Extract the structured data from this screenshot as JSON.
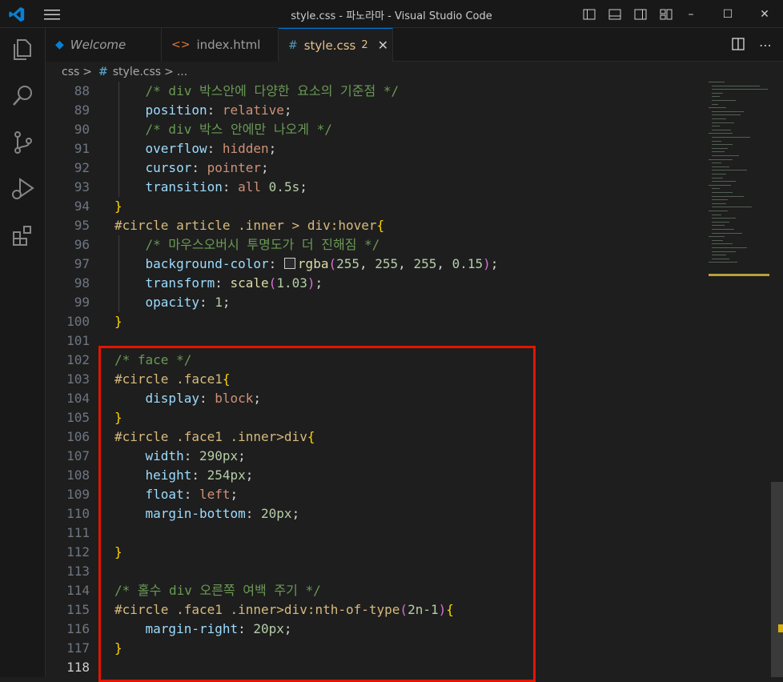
{
  "window": {
    "title": "style.css - 파노라마 - Visual Studio Code",
    "controls": {
      "minimize": "–",
      "maximize": "☐",
      "close": "✕"
    }
  },
  "activity_bar": [
    {
      "name": "explorer-icon"
    },
    {
      "name": "search-icon"
    },
    {
      "name": "source-control-icon"
    },
    {
      "name": "run-debug-icon"
    },
    {
      "name": "extensions-icon"
    }
  ],
  "tabs": [
    {
      "label": "Welcome",
      "icon": "vscode-icon",
      "active": false
    },
    {
      "label": "index.html",
      "icon": "html-icon",
      "active": false
    },
    {
      "label": "style.css",
      "icon": "css-icon",
      "active": true,
      "badge": "2",
      "close": "✕"
    }
  ],
  "breadcrumb": {
    "folder": "css",
    "sep": ">",
    "file": "style.css",
    "tail": "..."
  },
  "editor": {
    "lines": [
      {
        "n": "88",
        "indent": "    ",
        "tokens": [
          [
            "cm",
            "/* div 박스안에 다양한 요소의 기준점 */"
          ]
        ]
      },
      {
        "n": "89",
        "indent": "    ",
        "tokens": [
          [
            "pr",
            "position"
          ],
          [
            "pl",
            ": "
          ],
          [
            "vl",
            "relative"
          ],
          [
            "pl",
            ";"
          ]
        ]
      },
      {
        "n": "90",
        "indent": "    ",
        "tokens": [
          [
            "cm",
            "/* div 박스 안에만 나오게 */"
          ]
        ]
      },
      {
        "n": "91",
        "indent": "    ",
        "tokens": [
          [
            "pr",
            "overflow"
          ],
          [
            "pl",
            ": "
          ],
          [
            "vl",
            "hidden"
          ],
          [
            "pl",
            ";"
          ]
        ]
      },
      {
        "n": "92",
        "indent": "    ",
        "tokens": [
          [
            "pr",
            "cursor"
          ],
          [
            "pl",
            ": "
          ],
          [
            "vl",
            "pointer"
          ],
          [
            "pl",
            ";"
          ]
        ]
      },
      {
        "n": "93",
        "indent": "    ",
        "tokens": [
          [
            "pr",
            "transition"
          ],
          [
            "pl",
            ": "
          ],
          [
            "vl",
            "all"
          ],
          [
            "pl",
            " "
          ],
          [
            "nm",
            "0.5s"
          ],
          [
            "pl",
            ";"
          ]
        ]
      },
      {
        "n": "94",
        "indent": "",
        "tokens": [
          [
            "br",
            "}"
          ]
        ]
      },
      {
        "n": "95",
        "indent": "",
        "tokens": [
          [
            "sl",
            "#circle article .inner > div:hover"
          ],
          [
            "br",
            "{"
          ]
        ]
      },
      {
        "n": "96",
        "indent": "    ",
        "tokens": [
          [
            "cm",
            "/* 마우스오버시 투명도가 더 진해짐 */"
          ]
        ]
      },
      {
        "n": "97",
        "indent": "    ",
        "tokens": [
          [
            "pr",
            "background-color"
          ],
          [
            "pl",
            ": "
          ],
          [
            "sw",
            ""
          ],
          [
            "fn",
            "rgba"
          ],
          [
            "br2",
            "("
          ],
          [
            "nm",
            "255"
          ],
          [
            "pl",
            ", "
          ],
          [
            "nm",
            "255"
          ],
          [
            "pl",
            ", "
          ],
          [
            "nm",
            "255"
          ],
          [
            "pl",
            ", "
          ],
          [
            "nm",
            "0.15"
          ],
          [
            "br2",
            ")"
          ],
          [
            "pl",
            ";"
          ]
        ]
      },
      {
        "n": "98",
        "indent": "    ",
        "tokens": [
          [
            "pr",
            "transform"
          ],
          [
            "pl",
            ": "
          ],
          [
            "fn",
            "scale"
          ],
          [
            "br2",
            "("
          ],
          [
            "nm",
            "1.03"
          ],
          [
            "br2",
            ")"
          ],
          [
            "pl",
            ";"
          ]
        ]
      },
      {
        "n": "99",
        "indent": "    ",
        "tokens": [
          [
            "pr",
            "opacity"
          ],
          [
            "pl",
            ": "
          ],
          [
            "nm",
            "1"
          ],
          [
            "pl",
            ";"
          ]
        ]
      },
      {
        "n": "100",
        "indent": "",
        "tokens": [
          [
            "br",
            "}"
          ]
        ]
      },
      {
        "n": "101",
        "indent": "",
        "tokens": []
      },
      {
        "n": "102",
        "indent": "",
        "tokens": [
          [
            "cm",
            "/* face */"
          ]
        ]
      },
      {
        "n": "103",
        "indent": "",
        "tokens": [
          [
            "sl",
            "#circle .face1"
          ],
          [
            "br",
            "{"
          ]
        ]
      },
      {
        "n": "104",
        "indent": "    ",
        "tokens": [
          [
            "pr",
            "display"
          ],
          [
            "pl",
            ": "
          ],
          [
            "vl",
            "block"
          ],
          [
            "pl",
            ";"
          ]
        ]
      },
      {
        "n": "105",
        "indent": "",
        "tokens": [
          [
            "br",
            "}"
          ]
        ]
      },
      {
        "n": "106",
        "indent": "",
        "tokens": [
          [
            "sl",
            "#circle .face1 .inner>div"
          ],
          [
            "br",
            "{"
          ]
        ]
      },
      {
        "n": "107",
        "indent": "    ",
        "tokens": [
          [
            "pr",
            "width"
          ],
          [
            "pl",
            ": "
          ],
          [
            "nm",
            "290px"
          ],
          [
            "pl",
            ";"
          ]
        ]
      },
      {
        "n": "108",
        "indent": "    ",
        "tokens": [
          [
            "pr",
            "height"
          ],
          [
            "pl",
            ": "
          ],
          [
            "nm",
            "254px"
          ],
          [
            "pl",
            ";"
          ]
        ]
      },
      {
        "n": "109",
        "indent": "    ",
        "tokens": [
          [
            "pr",
            "float"
          ],
          [
            "pl",
            ": "
          ],
          [
            "vl",
            "left"
          ],
          [
            "pl",
            ";"
          ]
        ]
      },
      {
        "n": "110",
        "indent": "    ",
        "tokens": [
          [
            "pr",
            "margin-bottom"
          ],
          [
            "pl",
            ": "
          ],
          [
            "nm",
            "20px"
          ],
          [
            "pl",
            ";"
          ]
        ]
      },
      {
        "n": "111",
        "indent": "",
        "tokens": []
      },
      {
        "n": "112",
        "indent": "",
        "tokens": [
          [
            "br",
            "}"
          ]
        ]
      },
      {
        "n": "113",
        "indent": "",
        "tokens": []
      },
      {
        "n": "114",
        "indent": "",
        "tokens": [
          [
            "cm",
            "/* 홀수 div 오른쪽 여백 주기 */"
          ]
        ]
      },
      {
        "n": "115",
        "indent": "",
        "tokens": [
          [
            "sl",
            "#circle .face1 .inner>div:nth-of-type"
          ],
          [
            "br2",
            "("
          ],
          [
            "nm",
            "2n-1"
          ],
          [
            "br2",
            ")"
          ],
          [
            "br",
            "{"
          ]
        ]
      },
      {
        "n": "116",
        "indent": "    ",
        "tokens": [
          [
            "pr",
            "margin-right"
          ],
          [
            "pl",
            ": "
          ],
          [
            "nm",
            "20px"
          ],
          [
            "pl",
            ";"
          ]
        ]
      },
      {
        "n": "117",
        "indent": "",
        "tokens": [
          [
            "br",
            "}"
          ]
        ]
      },
      {
        "n": "118",
        "indent": "",
        "tokens": [],
        "current": true
      }
    ]
  }
}
